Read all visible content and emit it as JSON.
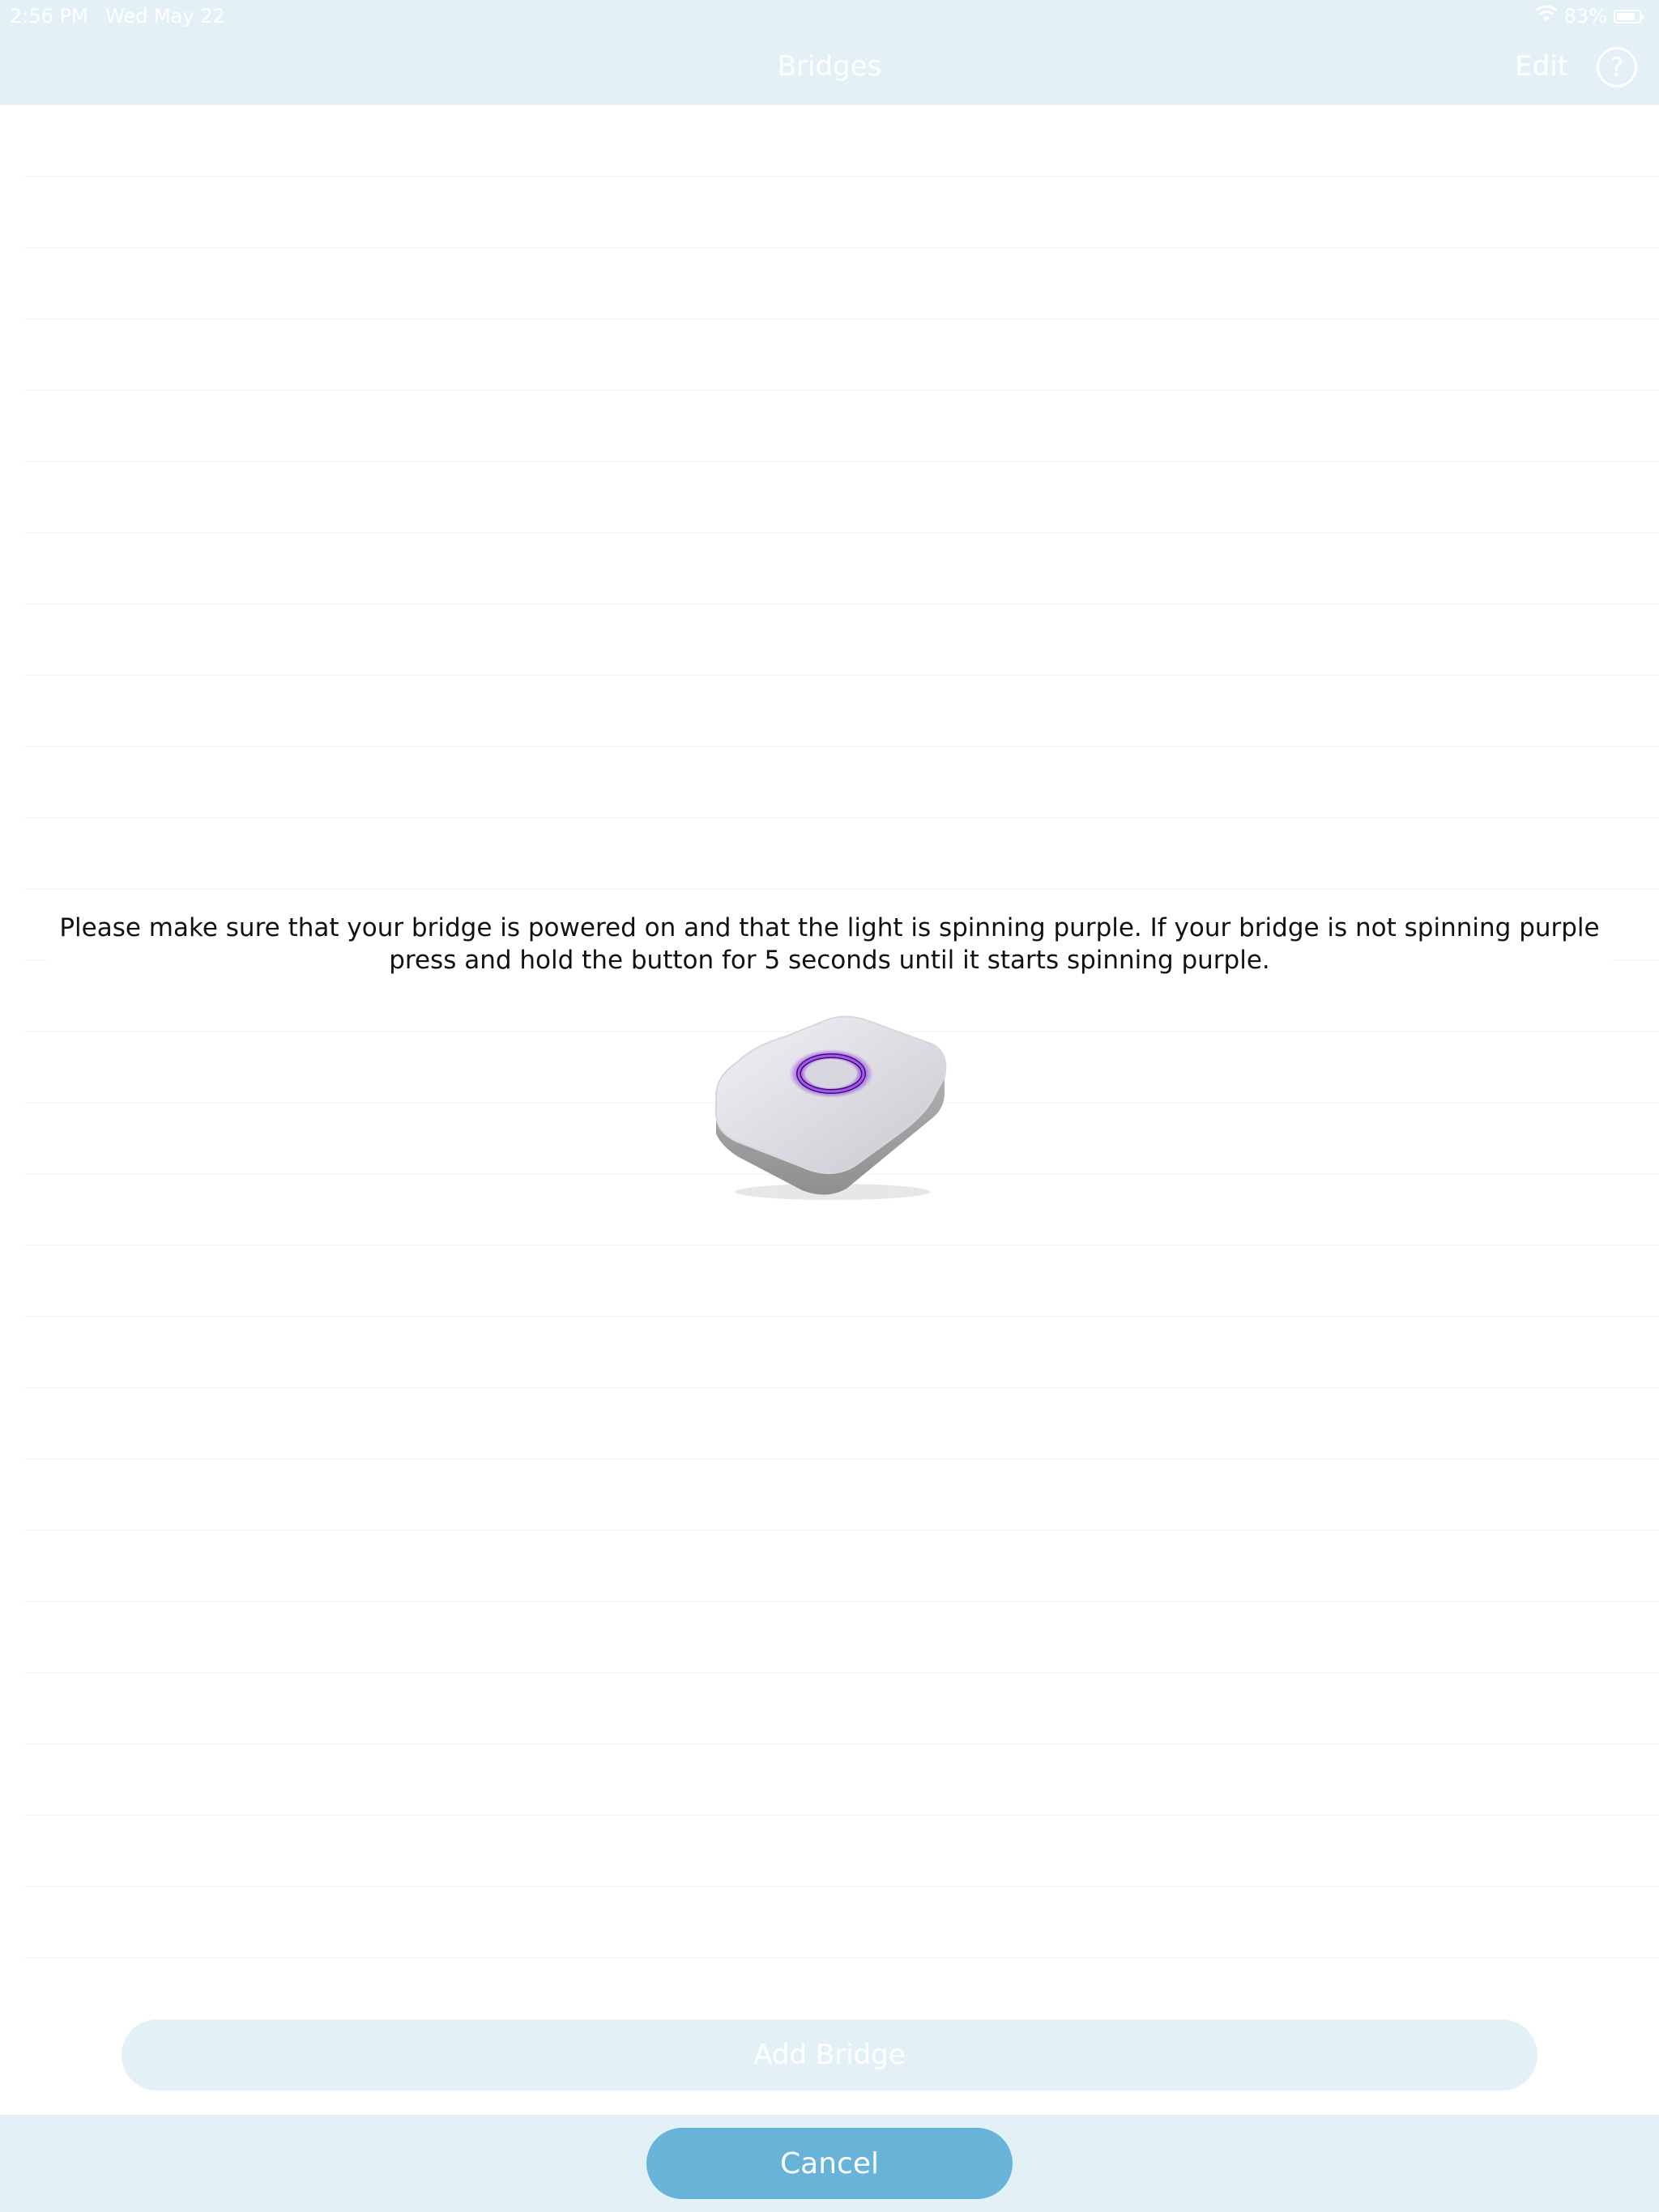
{
  "status_bar": {
    "time": "2:56 PM",
    "date": "Wed May 22",
    "battery": "83%",
    "battery_level": 0.83
  },
  "nav": {
    "title": "Bridges",
    "edit_label": "Edit",
    "help_label": "?"
  },
  "main": {
    "instructions": "Please make sure that your bridge is powered on and that the light is spinning purple. If your bridge is not spinning purple press and hold the button for 5 seconds until it starts spinning purple."
  },
  "actions": {
    "add_bridge_label": "Add Bridge",
    "cancel_label": "Cancel"
  },
  "colors": {
    "bar_background": "#e3f0f6",
    "cancel_button": "#68b4d9",
    "bridge_light": "#8a2be2"
  }
}
